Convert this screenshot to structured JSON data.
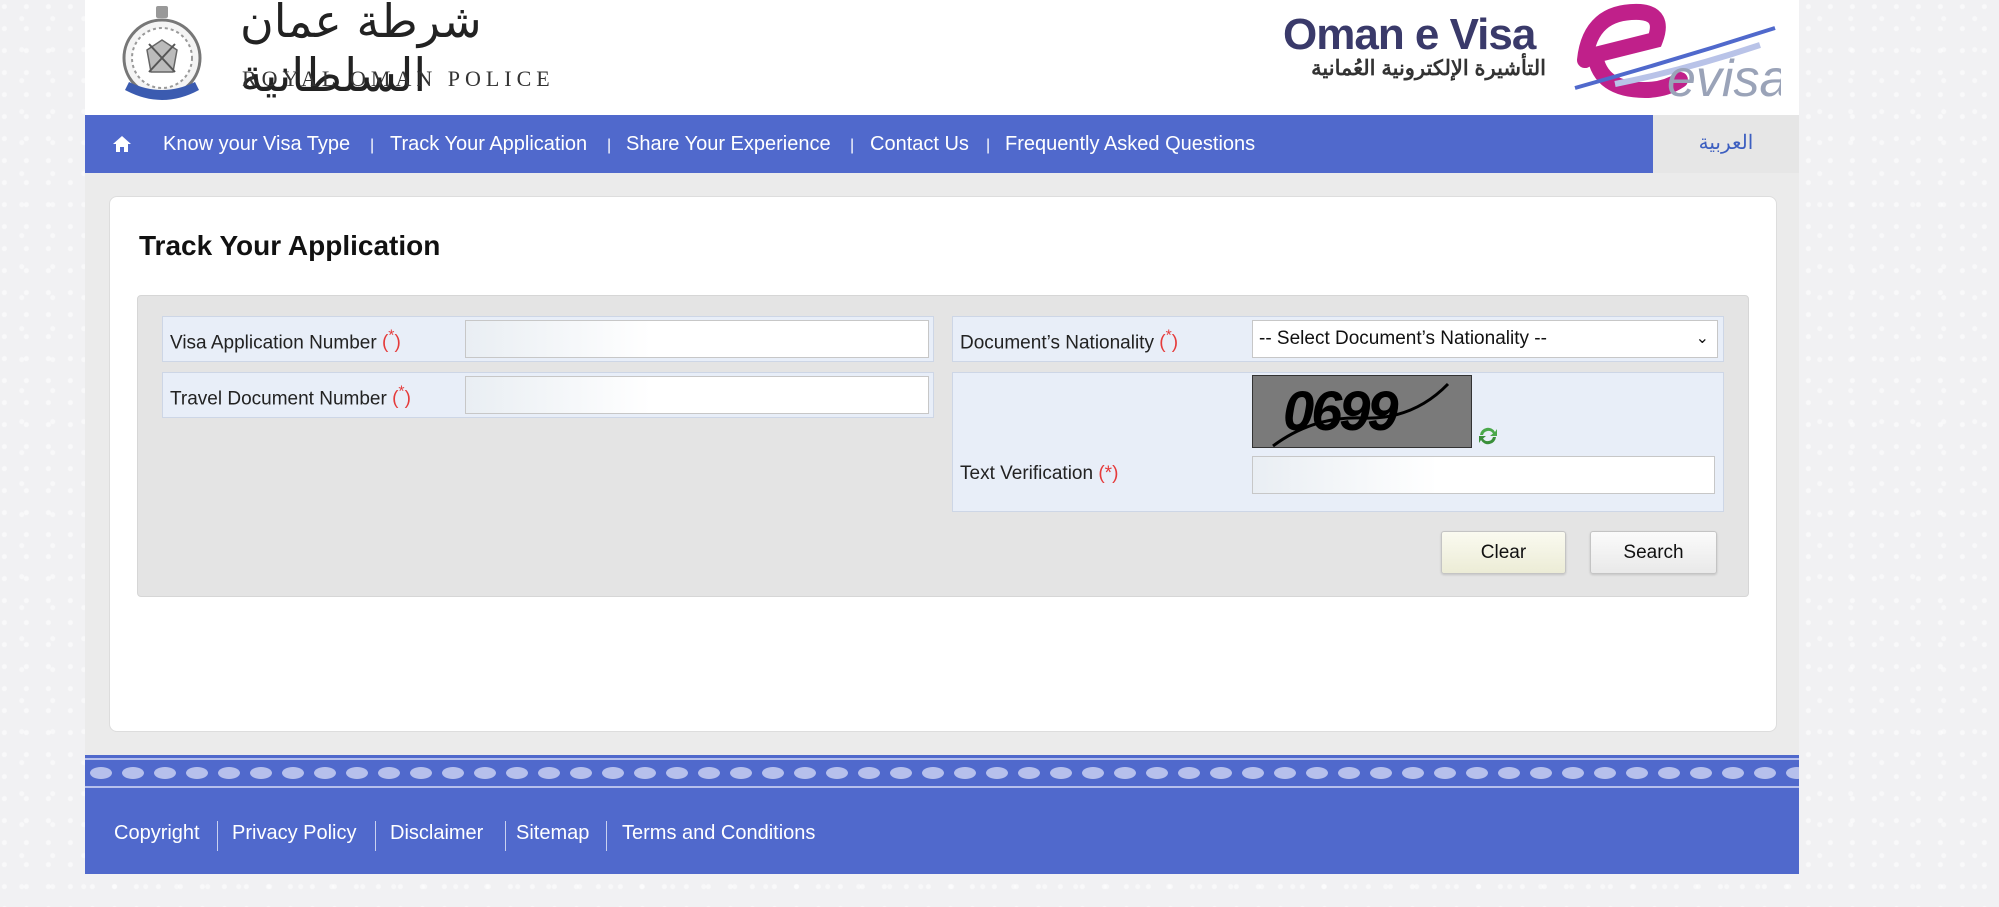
{
  "header": {
    "police_arabic": "شرطة عمان السلطانية",
    "police_english": "ROYAL OMAN POLICE",
    "evisa_title": "Oman e Visa",
    "evisa_arabic": "التأشيرة الإلكترونية العُمانية",
    "evisa_logo_text": "evisa"
  },
  "nav": {
    "home_icon": "home-icon",
    "items": [
      {
        "label": "Know your Visa Type"
      },
      {
        "label": "Track Your Application"
      },
      {
        "label": "Share Your Experience"
      },
      {
        "label": "Contact Us"
      },
      {
        "label": "Frequently Asked Questions"
      }
    ],
    "separator": "|",
    "language_label": "العربية"
  },
  "page": {
    "title": "Track Your Application"
  },
  "form": {
    "visa_number": {
      "label": "Visa Application Number",
      "value": ""
    },
    "travel_doc": {
      "label": "Travel Document Number",
      "value": ""
    },
    "nationality": {
      "label": "Document’s Nationality",
      "selected": "-- Select Document’s Nationality --"
    },
    "verification": {
      "label": "Text Verification",
      "value": ""
    },
    "required_open": "(",
    "required_star": "*",
    "required_close": ")",
    "required_marker": "(*)",
    "captcha_text": "0699",
    "refresh_icon": "refresh-icon",
    "chevron_icon": "chevron-down-icon",
    "clear_label": "Clear",
    "search_label": "Search"
  },
  "footer": {
    "links": [
      {
        "label": "Copyright"
      },
      {
        "label": "Privacy Policy"
      },
      {
        "label": "Disclaimer"
      },
      {
        "label": "Sitemap"
      },
      {
        "label": "Terms and Conditions"
      }
    ]
  },
  "colors": {
    "nav_bg": "#5069cc",
    "required": "#e53b3b",
    "evisa_magenta": "#c0208a",
    "language_text": "#3d5fc0"
  }
}
